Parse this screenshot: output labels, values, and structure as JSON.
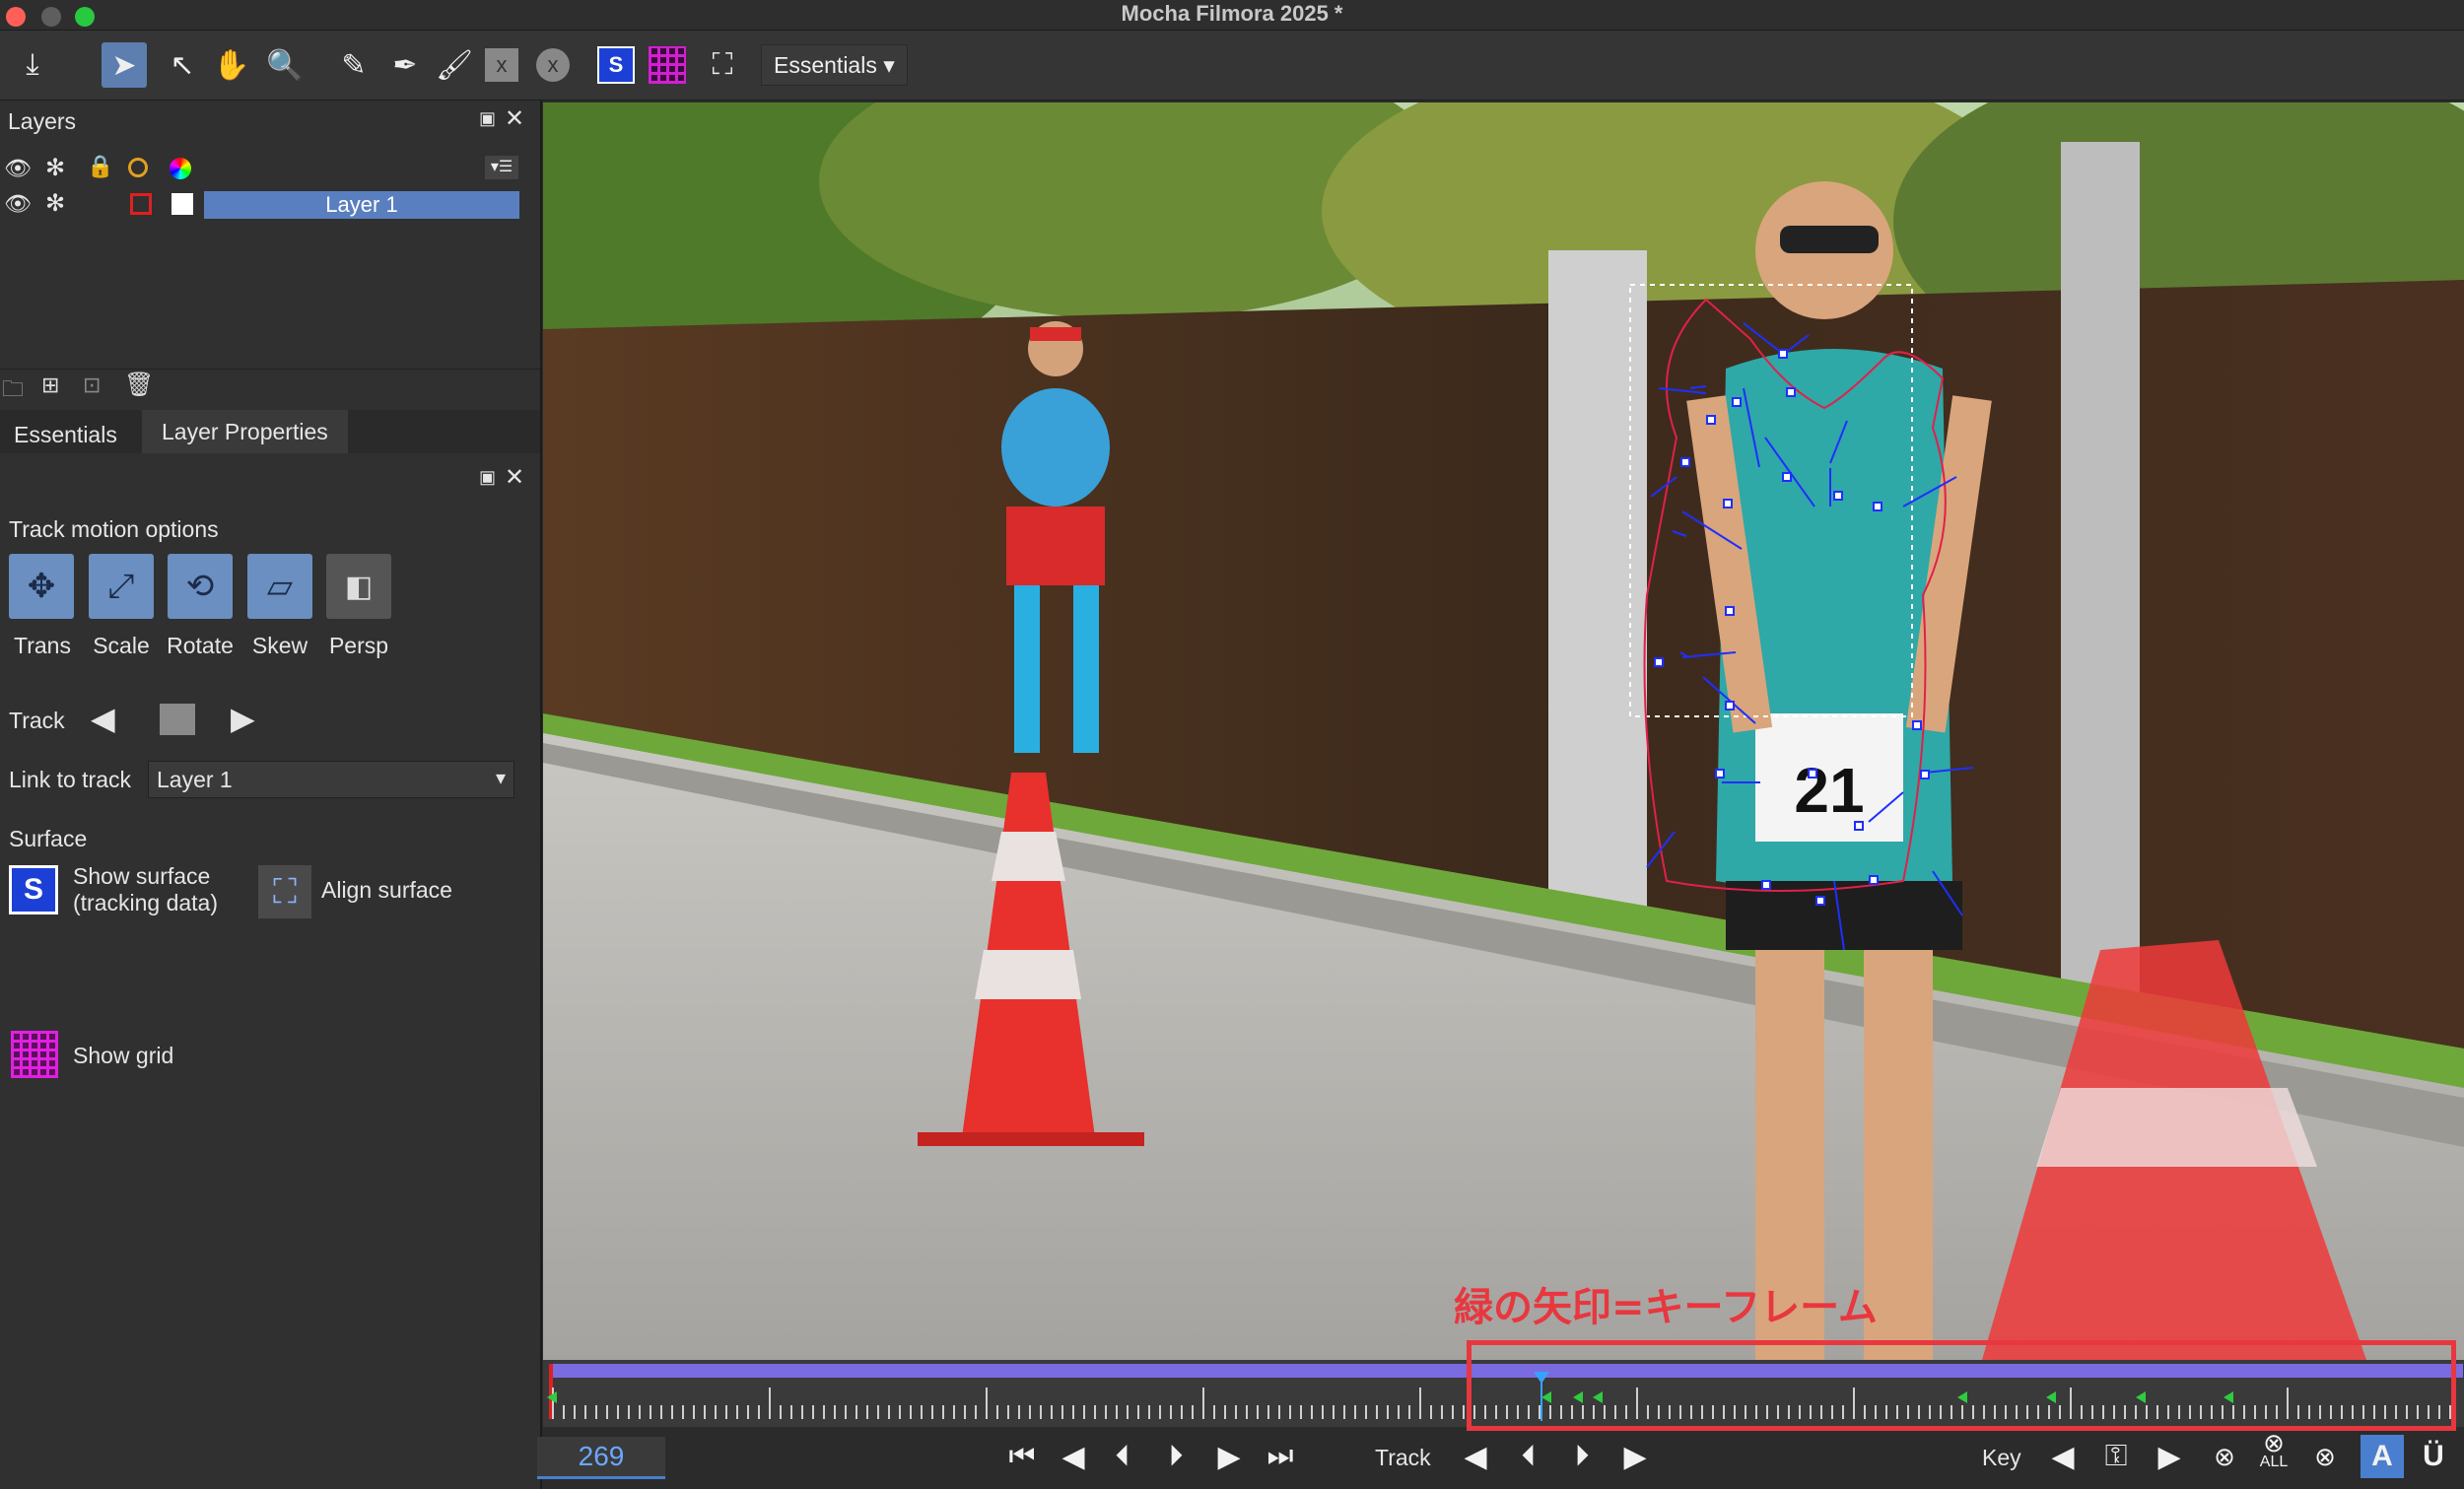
{
  "window": {
    "title": "Mocha Filmora 2025 *"
  },
  "toolbar": {
    "workspace": "Essentials",
    "icons": [
      "download-icon",
      "pointer-icon",
      "add-point-icon",
      "hand-icon",
      "zoom-icon",
      "xspline-icon",
      "bezier-icon",
      "brush-icon",
      "x-icon",
      "circle-x-icon",
      "surface-icon",
      "grid-icon",
      "align-surface-icon"
    ]
  },
  "layers_panel": {
    "title": "Layers",
    "layer_name": "Layer 1"
  },
  "tabs": {
    "essentials": "Essentials",
    "layer_properties": "Layer Properties"
  },
  "track_options": {
    "heading": "Track motion options",
    "buttons": [
      {
        "label": "Trans",
        "active": true
      },
      {
        "label": "Scale",
        "active": true
      },
      {
        "label": "Rotate",
        "active": true
      },
      {
        "label": "Skew",
        "active": true
      },
      {
        "label": "Persp",
        "active": false
      }
    ],
    "track_label": "Track",
    "link_label": "Link to track",
    "link_value": "Layer 1"
  },
  "surface": {
    "heading": "Surface",
    "show_surface": "Show surface\n(tracking data)",
    "show_surface_line1": "Show surface",
    "show_surface_line2": "(tracking data)",
    "align_surface": "Align surface",
    "show_grid": "Show grid"
  },
  "annotation": {
    "text": "緑の矢印=キーフレーム",
    "color": "#e8373f"
  },
  "timeline": {
    "frame": "269",
    "track_label": "Track",
    "key_label": "Key",
    "all_label": "ALL",
    "a_label": "A",
    "u_label": "Ü"
  },
  "colors": {
    "accent": "#5c7fb0",
    "keyframe": "#2ecc40",
    "spline": "#1f2fff",
    "range": "#7b6be0"
  },
  "bib_number": "21"
}
